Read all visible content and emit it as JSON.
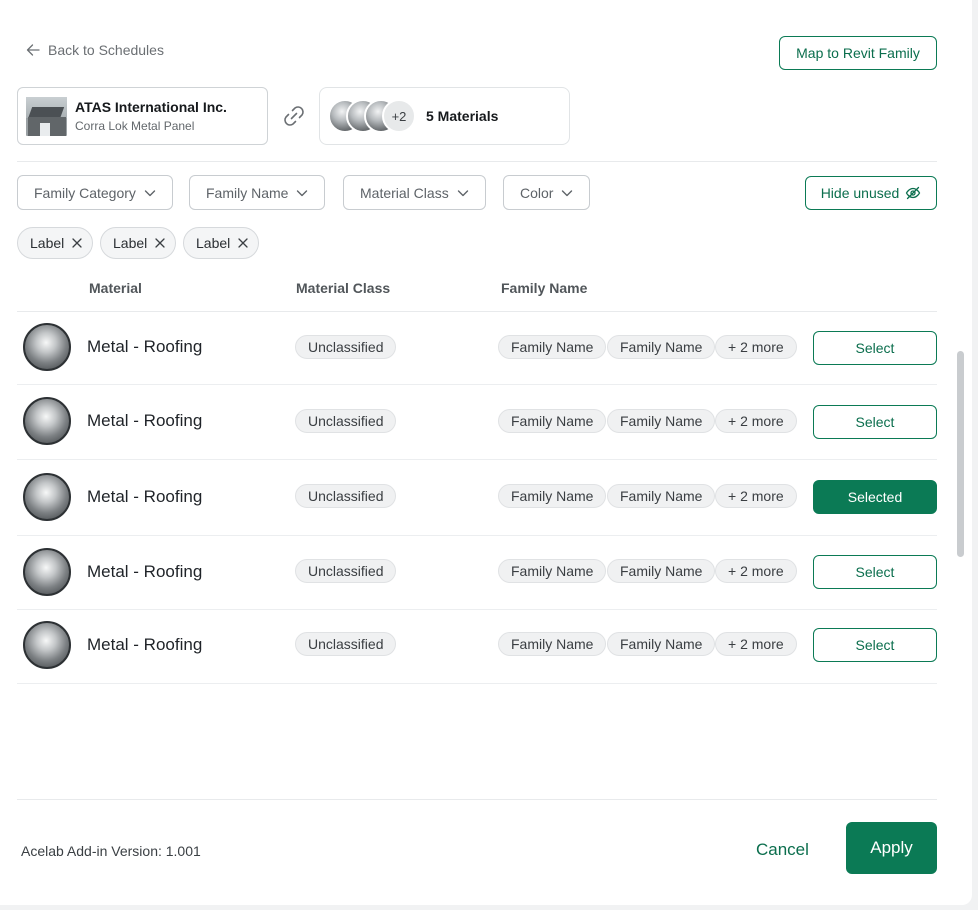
{
  "header": {
    "back_label": "Back to Schedules",
    "map_button_label": "Map to Revit Family"
  },
  "product": {
    "name": "ATAS International Inc.",
    "subtitle": "Corra Lok Metal Panel"
  },
  "materials_summary": {
    "extra_count": "+2",
    "label": "5 Materials"
  },
  "filters": [
    {
      "label": "Family Category"
    },
    {
      "label": "Family Name"
    },
    {
      "label": "Material Class"
    },
    {
      "label": "Color"
    }
  ],
  "hide_unused_label": "Hide unused",
  "chips": [
    {
      "label": "Label"
    },
    {
      "label": "Label"
    },
    {
      "label": "Label"
    }
  ],
  "table": {
    "headers": {
      "material": "Material",
      "material_class": "Material Class",
      "family_name": "Family Name"
    },
    "rows": [
      {
        "material": "Metal - Roofing",
        "material_class": "Unclassified",
        "family1": "Family Name",
        "family2": "Family Name",
        "more": "+ 2 more",
        "action": "Select",
        "selected": false
      },
      {
        "material": "Metal - Roofing",
        "material_class": "Unclassified",
        "family1": "Family Name",
        "family2": "Family Name",
        "more": "+ 2 more",
        "action": "Select",
        "selected": false
      },
      {
        "material": "Metal - Roofing",
        "material_class": "Unclassified",
        "family1": "Family Name",
        "family2": "Family Name",
        "more": "+ 2 more",
        "action": "Selected",
        "selected": true
      },
      {
        "material": "Metal - Roofing",
        "material_class": "Unclassified",
        "family1": "Family Name",
        "family2": "Family Name",
        "more": "+ 2 more",
        "action": "Select",
        "selected": false
      },
      {
        "material": "Metal - Roofing",
        "material_class": "Unclassified",
        "family1": "Family Name",
        "family2": "Family Name",
        "more": "+ 2 more",
        "action": "Select",
        "selected": false
      }
    ]
  },
  "footer": {
    "version": "Acelab Add-in Version: 1.001",
    "cancel_label": "Cancel",
    "apply_label": "Apply"
  },
  "colors": {
    "accent": "#0b7a55",
    "border": "#c8ccd0",
    "pill_bg": "#f0f1f2"
  },
  "icons": {
    "back": "arrow-left-icon",
    "link": "link-icon",
    "chevron": "chevron-down-icon",
    "hide": "eye-off-icon",
    "remove": "close-icon"
  }
}
